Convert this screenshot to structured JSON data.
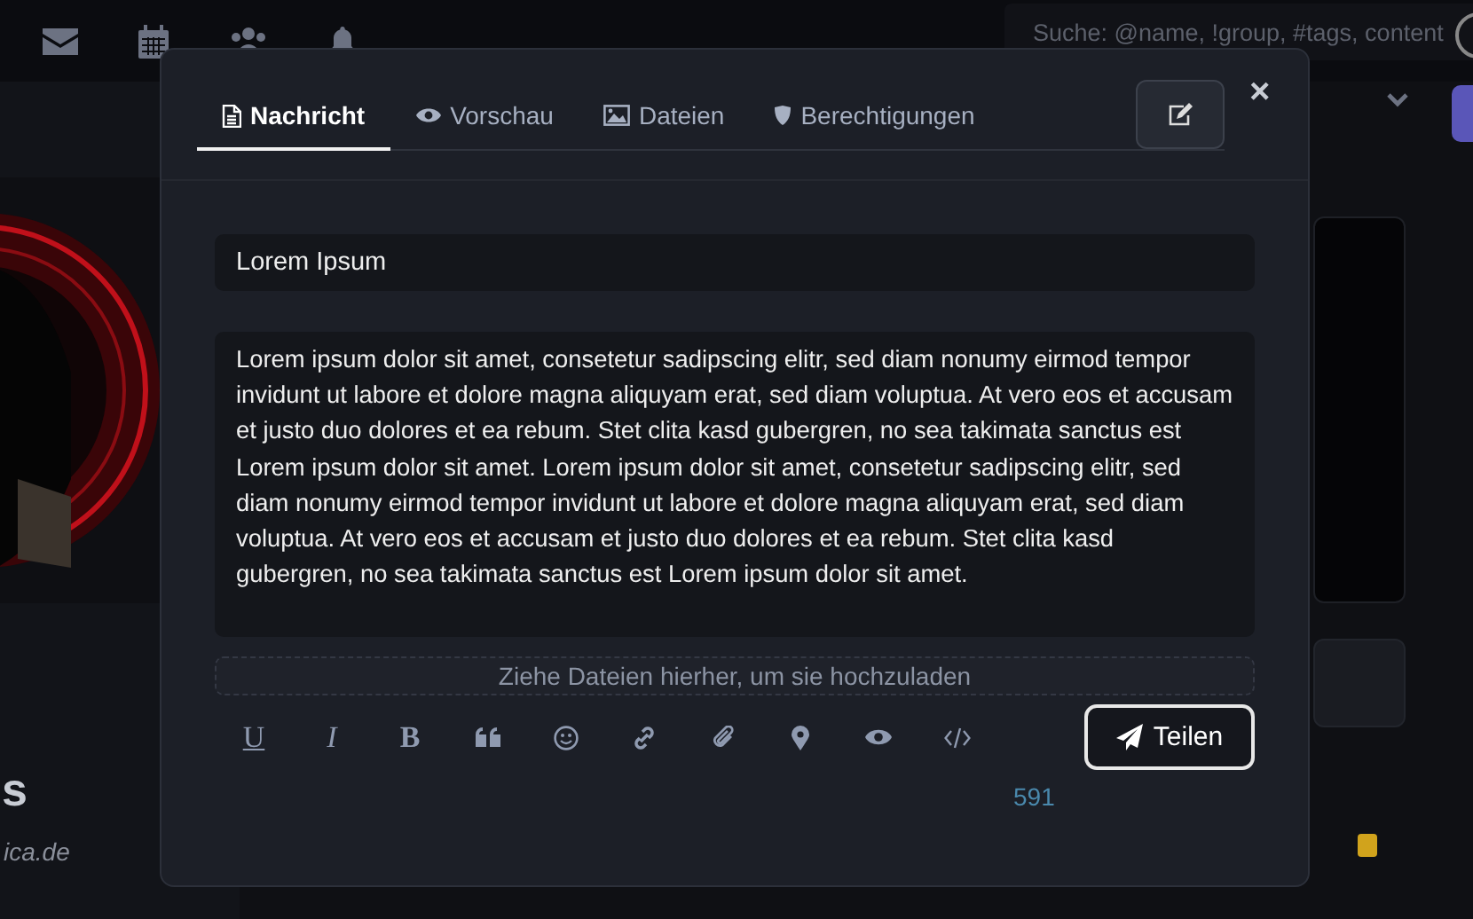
{
  "search": {
    "placeholder": "Suche: @name, !group, #tags, content"
  },
  "profile": {
    "name": "s",
    "email": "ica.de"
  },
  "dialog": {
    "tabs": [
      {
        "label": "Nachricht",
        "selected": true
      },
      {
        "label": "Vorschau",
        "selected": false
      },
      {
        "label": "Dateien",
        "selected": false
      },
      {
        "label": "Berechtigungen",
        "selected": false
      }
    ],
    "close": "×",
    "title_field": {
      "value": "Lorem Ipsum"
    },
    "body_field": {
      "value": "Lorem ipsum dolor sit amet, consetetur sadipscing elitr, sed diam nonumy eirmod tempor invidunt ut labore et dolore magna aliquyam erat, sed diam voluptua. At vero eos et accusam et justo duo dolores et ea rebum. Stet clita kasd gubergren, no sea takimata sanctus est Lorem ipsum dolor sit amet. Lorem ipsum dolor sit amet, consetetur sadipscing elitr, sed diam nonumy eirmod tempor invidunt ut labore et dolore magna aliquyam erat, sed diam voluptua. At vero eos et accusam et justo duo dolores et ea rebum. Stet clita kasd gubergren, no sea takimata sanctus est Lorem ipsum dolor sit amet."
    },
    "dropzone": "Ziehe Dateien hierher, um sie hochzuladen",
    "format_buttons": [
      "U",
      "I",
      "B"
    ],
    "submit": "Teilen",
    "counter": "591"
  }
}
